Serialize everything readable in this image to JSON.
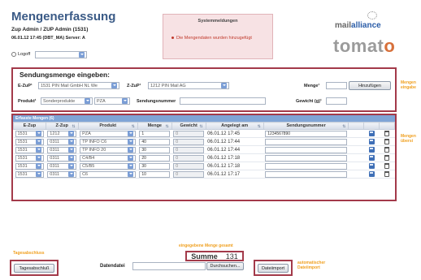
{
  "header": {
    "title": "Mengenerfassung",
    "subtitle": "Zup Admin / ZUP Admin (1531)",
    "meta": "06.01.12 17:45 (DBT_MA) Server: A",
    "logout_label": "Logoff",
    "lang_value": ""
  },
  "system_messages": {
    "title": "Systemmeldungen",
    "message": "Die Mengendaten wurden hinzugefügt"
  },
  "brand": {
    "top_prefix": "mail",
    "top_accent": "alliance",
    "tag": "",
    "main_prefix": "tomat",
    "main_accent": "o"
  },
  "entry": {
    "title": "Sendungsmenge eingeben:",
    "ezup_label": "E-ZuP¹",
    "ezup_value": "1531 PIN Mail GmbH NL We",
    "zzup_label": "Z-ZuP¹",
    "zzup_value": "1212 PIN Mail AG",
    "menge_label": "Menge¹",
    "menge_value": "",
    "add_button": "Hinzufügen",
    "produkt_label": "Produkt¹",
    "produkt_value": "Sonderprodukte",
    "subprodukt_value": "PZA",
    "sendungsnummer_label": "Sendungsnummer",
    "sendungsnummer_value": "",
    "gewicht_label": "Gewicht (g)¹",
    "gewicht_value": ""
  },
  "notes": {
    "menge_eingabe": "Mengen\neingabe",
    "mengen_uebersicht": "Mengen\nübersi",
    "tagesabschluss": "Tagesabschluss",
    "summe": "eingegebene Menge gesamt",
    "dateiimport": "automatischer\nDateiimport"
  },
  "table": {
    "caption": "Erfasste Mengen (6)",
    "columns": [
      "E-Zup",
      "Z-Zup",
      "Produkt",
      "Menge",
      "Gewicht",
      "Angelegt am",
      "Sendungsnummer"
    ],
    "rows": [
      {
        "ezup": "1531",
        "zzup": "1212",
        "produkt": "PZA",
        "menge": "1",
        "gewicht": "0",
        "angelegt": "06.01.12 17:45",
        "nummer": "1234567890"
      },
      {
        "ezup": "1531",
        "zzup": "0311",
        "produkt": "TP INFO C6",
        "menge": "40",
        "gewicht": "0",
        "angelegt": "06.01.12 17:44",
        "nummer": ""
      },
      {
        "ezup": "1531",
        "zzup": "0311",
        "produkt": "TP INFO 20",
        "menge": "30",
        "gewicht": "0",
        "angelegt": "06.01.12 17:44",
        "nummer": ""
      },
      {
        "ezup": "1531",
        "zzup": "0311",
        "produkt": "C4/B4",
        "menge": "20",
        "gewicht": "0",
        "angelegt": "06.01.12 17:18",
        "nummer": ""
      },
      {
        "ezup": "1531",
        "zzup": "0311",
        "produkt": "C5/B5",
        "menge": "30",
        "gewicht": "0",
        "angelegt": "06.01.12 17:18",
        "nummer": ""
      },
      {
        "ezup": "1531",
        "zzup": "0311",
        "produkt": "C6",
        "menge": "10",
        "gewicht": "0",
        "angelegt": "06.01.12 17:17",
        "nummer": ""
      }
    ]
  },
  "summary": {
    "label": "Summe",
    "value": "131"
  },
  "footer": {
    "day_close_button": "Tagesabschluß",
    "file_label": "Datendatei",
    "file_value": "",
    "browse_button": "Durchsuchen...",
    "import_button": "Dateiimport"
  },
  "colors": {
    "accent_border": "#a33a4a",
    "note_orange": "#f0a020",
    "caption_blue": "#7fa4d6",
    "brand_orange": "#d7703b"
  }
}
